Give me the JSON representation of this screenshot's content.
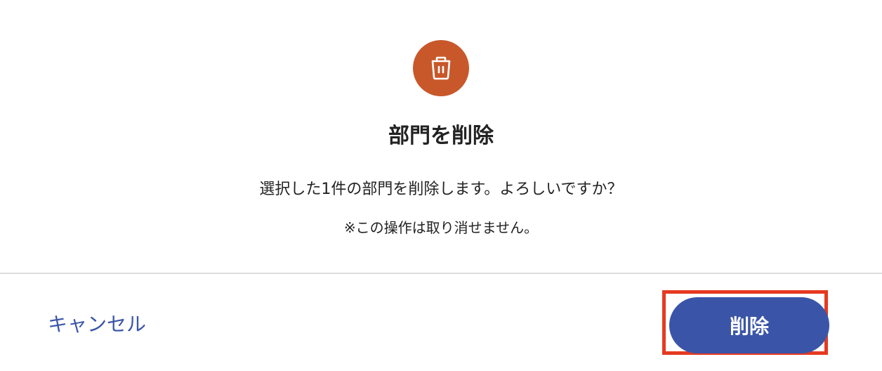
{
  "dialog": {
    "title": "部門を削除",
    "message": "選択した1件の部門を削除します。よろしいですか？",
    "warning": "※この操作は取り消せません。",
    "icon": "trash-icon"
  },
  "actions": {
    "cancel_label": "キャンセル",
    "delete_label": "削除"
  },
  "colors": {
    "icon_bg": "#c8582a",
    "primary": "#3a55a8",
    "link": "#3a55a8",
    "highlight": "#e53a21"
  }
}
